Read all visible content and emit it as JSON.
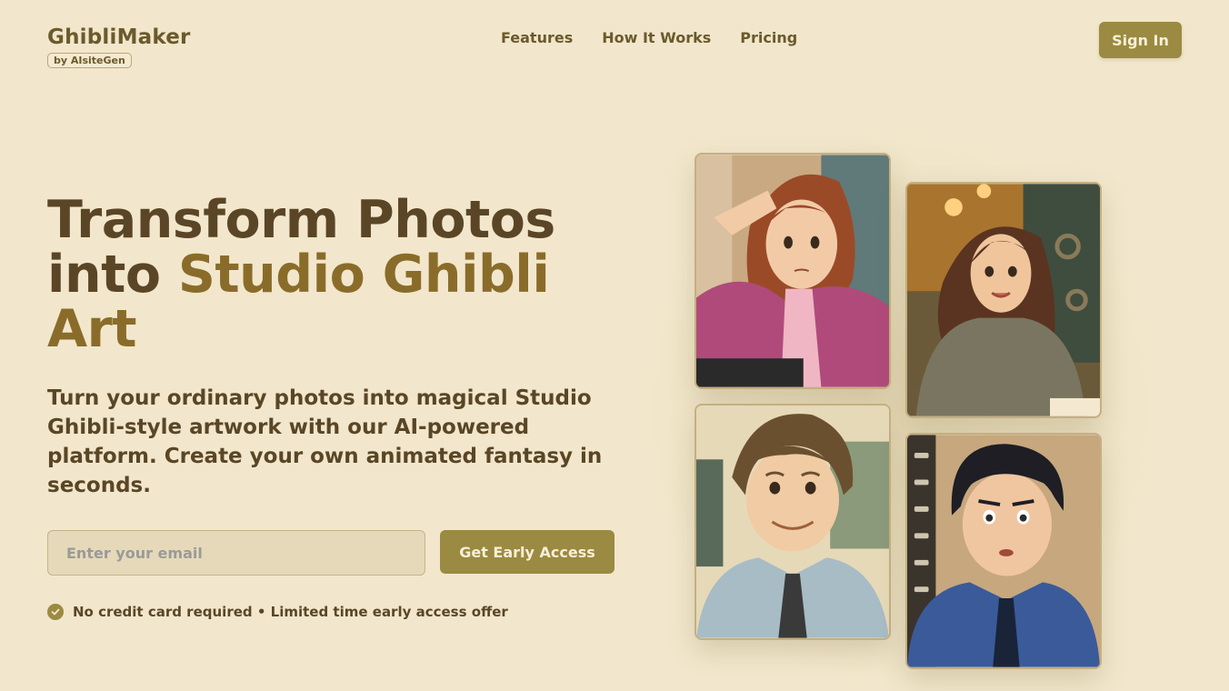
{
  "header": {
    "brand_name": "GhibliMaker",
    "brand_badge": "by AIsiteGen",
    "nav": [
      "Features",
      "How It Works",
      "Pricing"
    ],
    "signin_label": "Sign In"
  },
  "hero": {
    "title_line1": "Transform Photos",
    "title_line2_a": "into ",
    "title_line2_b": "Studio Ghibli",
    "title_line3": "Art",
    "subtitle": "Turn your ordinary photos into magical Studio Ghibli-style artwork with our AI-powered platform. Create your own animated fantasy in seconds.",
    "email_placeholder": "Enter your email",
    "cta_label": "Get Early Access",
    "note": "No credit card required • Limited time early access offer"
  },
  "colors": {
    "background": "#f2e7cc",
    "accent": "#9b8a42",
    "heading": "#5a4626"
  },
  "icons": [
    "check-circle-icon"
  ],
  "gallery": [
    "saluting-woman-illustration",
    "smiling-woman-sweater-illustration",
    "smiling-man-tie-illustration",
    "surprised-man-blue-shirt-illustration"
  ]
}
